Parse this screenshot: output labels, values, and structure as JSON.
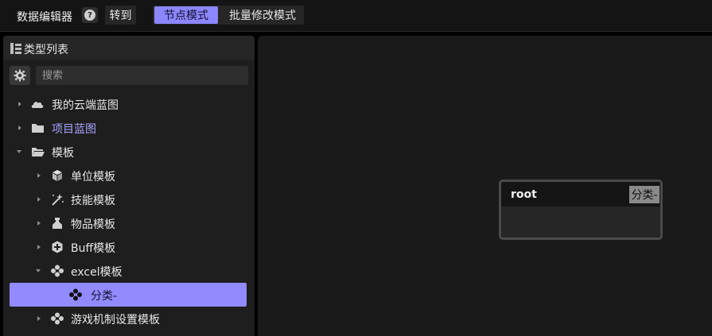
{
  "toolbar": {
    "title": "数据编辑器",
    "help_symbol": "?",
    "goto_label": "转到",
    "modes": {
      "node": "节点模式",
      "bulk": "批量修改模式"
    },
    "active_mode": "node",
    "accent_color": "#8c86ff"
  },
  "left_panel": {
    "title": "类型列表",
    "search": {
      "placeholder": "搜索",
      "value": ""
    },
    "tree": [
      {
        "label": "我的云端蓝图",
        "icon": "cloud-icon",
        "level": 0,
        "expanded": false
      },
      {
        "label": "项目蓝图",
        "icon": "folder-icon",
        "level": 0,
        "expanded": false,
        "highlight": true
      },
      {
        "label": "模板",
        "icon": "folder-open-icon",
        "level": 0,
        "expanded": true
      },
      {
        "label": "单位模板",
        "icon": "cube-icon",
        "level": 1,
        "expanded": false
      },
      {
        "label": "技能模板",
        "icon": "magic-wand-icon",
        "level": 1,
        "expanded": false
      },
      {
        "label": "物品模板",
        "icon": "potion-icon",
        "level": 1,
        "expanded": false
      },
      {
        "label": "Buff模板",
        "icon": "hexagon-plus-icon",
        "level": 1,
        "expanded": false
      },
      {
        "label": "excel模板",
        "icon": "cluster-icon",
        "level": 1,
        "expanded": true
      },
      {
        "label": "分类-",
        "icon": "cluster-icon",
        "level": 2,
        "selected": true
      },
      {
        "label": "游戏机制设置模板",
        "icon": "cluster-icon",
        "level": 1,
        "expanded": false
      }
    ]
  },
  "canvas": {
    "node": {
      "title": "root",
      "tag": "分类-"
    }
  }
}
